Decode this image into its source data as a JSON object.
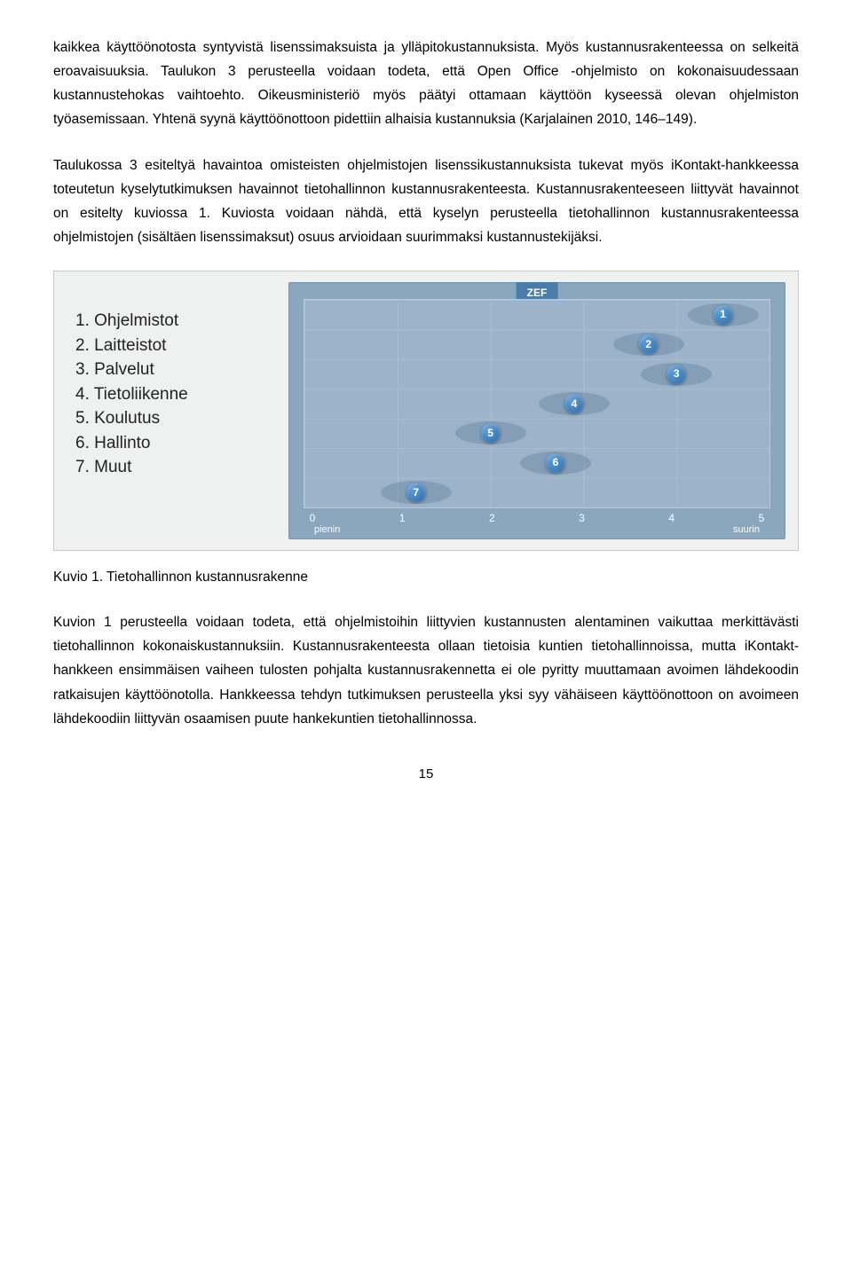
{
  "paragraphs": {
    "p1": "kaikkea käyttöönotosta syntyvistä lisenssimaksuista ja ylläpitokustannuksista. Myös kustannusrakenteessa on selkeitä eroavaisuuksia. Taulukon 3 perusteella voidaan todeta, että Open Office -ohjelmisto on kokonaisuudessaan kustannustehokas vaihtoehto. Oikeusministeriö myös päätyi ottamaan käyttöön kyseessä olevan ohjelmiston työasemissaan. Yhtenä syynä käyttöönottoon pidettiin alhaisia kustannuksia (Karjalainen 2010, 146–149).",
    "p2": "Taulukossa 3 esiteltyä havaintoa omisteisten ohjelmistojen lisenssikustannuksista tukevat myös iKontakt-hankkeessa toteutetun kyselytutkimuksen havainnot tietohallinnon kustannusrakenteesta. Kustannusrakenteeseen liittyvät havainnot on esitelty kuviossa 1. Kuviosta voidaan nähdä, että kyselyn perusteella tietohallinnon kustannusrakenteessa ohjelmistojen (sisältäen lisenssimaksut) osuus arvioidaan suurimmaksi kustannustekijäksi.",
    "p3": "Kuvion 1 perusteella voidaan todeta, että ohjelmistoihin liittyvien kustannusten alentaminen vaikuttaa merkittävästi tietohallinnon kokonaiskustannuksiin. Kustannusrakenteesta ollaan tietoisia kuntien tietohallinnoissa, mutta iKontakt-hankkeen ensimmäisen vaiheen tulosten pohjalta kustannusrakennetta ei ole pyritty muuttamaan avoimen lähdekoodin ratkaisujen käyttöönotolla. Hankkeessa tehdyn tutkimuksen perusteella yksi syy vähäiseen käyttöönottoon on avoimeen lähdekoodiin liittyvän osaamisen puute hankekuntien tietohallinnossa."
  },
  "legend": {
    "i1": "1. Ohjelmistot",
    "i2": "2. Laitteistot",
    "i3": "3. Palvelut",
    "i4": "4. Tietoliikenne",
    "i5": "5. Koulutus",
    "i6": "6. Hallinto",
    "i7": "7. Muut"
  },
  "chart_data": {
    "type": "scatter",
    "title": "ZEF",
    "xlabel_left": "pienin",
    "xlabel_right": "suurin",
    "ticks": [
      "0",
      "1",
      "2",
      "3",
      "4",
      "5"
    ],
    "xlim": [
      0,
      5
    ],
    "item_count": 7,
    "series": [
      {
        "id": "1",
        "label": "Ohjelmistot",
        "x": 4.5,
        "row": 1
      },
      {
        "id": "2",
        "label": "Laitteistot",
        "x": 3.7,
        "row": 2
      },
      {
        "id": "3",
        "label": "Palvelut",
        "x": 4.0,
        "row": 3
      },
      {
        "id": "4",
        "label": "Tietoliikenne",
        "x": 2.9,
        "row": 4
      },
      {
        "id": "5",
        "label": "Koulutus",
        "x": 2.0,
        "row": 5
      },
      {
        "id": "6",
        "label": "Hallinto",
        "x": 2.7,
        "row": 6
      },
      {
        "id": "7",
        "label": "Muut",
        "x": 1.2,
        "row": 7
      }
    ]
  },
  "caption": "Kuvio 1. Tietohallinnon kustannusrakenne",
  "page_number": "15"
}
